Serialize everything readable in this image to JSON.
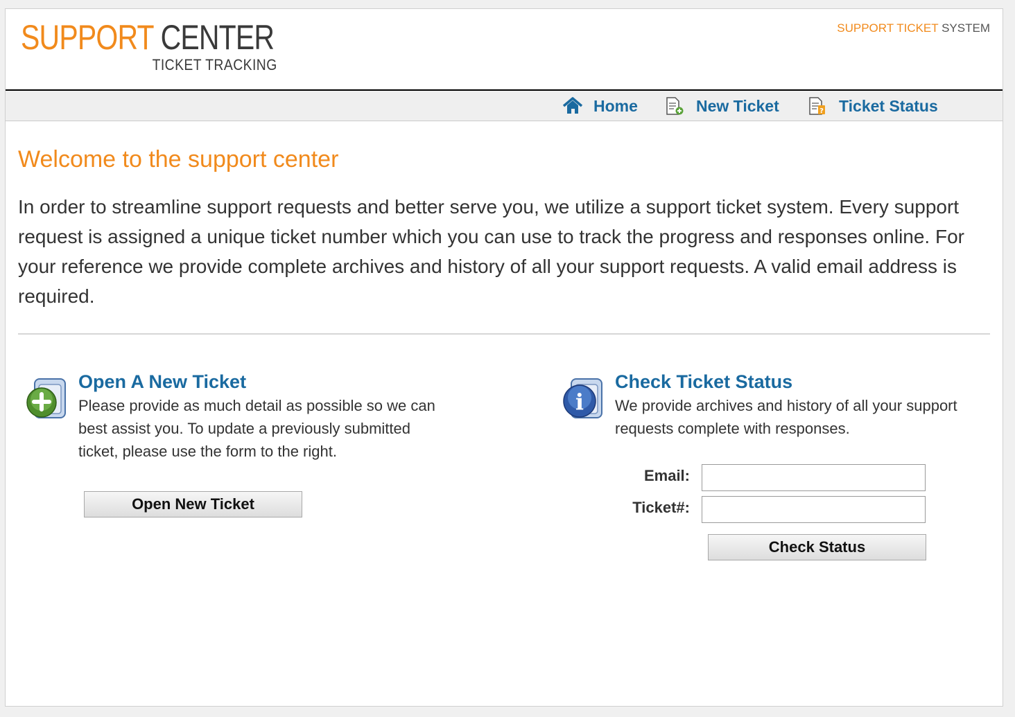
{
  "header": {
    "logo_word1": "SUPPORT",
    "logo_word2": "CENTER",
    "logo_sub": "TICKET TRACKING",
    "tagline_accent": "SUPPORT TICKET",
    "tagline_rest": "SYSTEM"
  },
  "nav": {
    "items": [
      {
        "label": "Home",
        "icon": "home-icon"
      },
      {
        "label": "New Ticket",
        "icon": "new-ticket-icon"
      },
      {
        "label": "Ticket Status",
        "icon": "ticket-status-icon"
      }
    ]
  },
  "main": {
    "title": "Welcome to the support center",
    "intro": "In order to streamline support requests and better serve you, we utilize a support ticket system. Every support request is assigned a unique ticket number which you can use to track the progress and responses online. For your reference we provide complete archives and history of all your support requests. A valid email address is required."
  },
  "open_ticket": {
    "heading": "Open A New Ticket",
    "description": "Please provide as much detail as possible so we can best assist you. To update a previously submitted ticket, please use the form to the right.",
    "button_label": "Open New Ticket",
    "icon": "add-ticket-icon"
  },
  "check_status": {
    "heading": "Check Ticket Status",
    "description": "We provide archives and history of all your support requests complete with responses.",
    "email_label": "Email:",
    "email_value": "",
    "ticket_label": "Ticket#:",
    "ticket_value": "",
    "button_label": "Check Status",
    "icon": "info-icon"
  },
  "colors": {
    "accent": "#f18a1c",
    "link": "#1a6aa0",
    "text": "#333333"
  }
}
